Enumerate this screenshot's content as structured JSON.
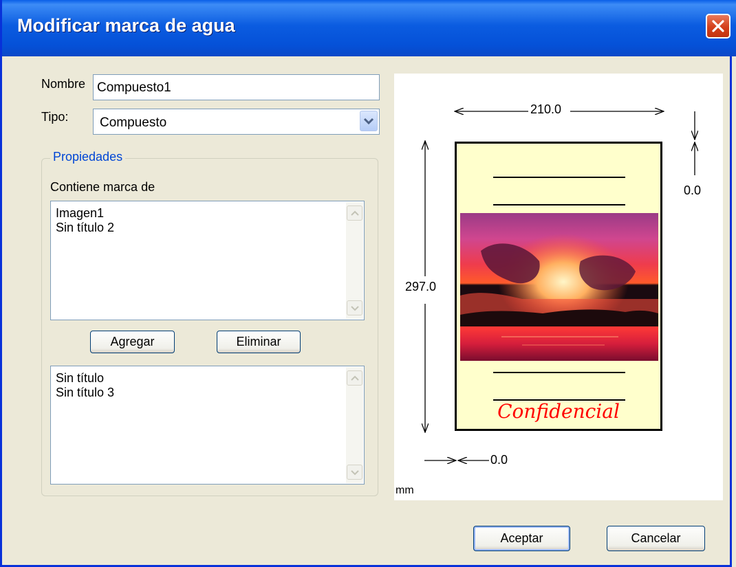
{
  "window": {
    "title": "Modificar marca de agua"
  },
  "form": {
    "name_label": "Nombre",
    "name_value": "Compuesto1",
    "type_label": "Tipo:",
    "type_value": "Compuesto"
  },
  "properties": {
    "legend": "Propiedades",
    "contains_label": "Contiene marca de",
    "included": [
      "Imagen1",
      "Sin título 2"
    ],
    "available": [
      "Sin título",
      "Sin título 3"
    ],
    "add_label": "Agregar",
    "remove_label": "Eliminar"
  },
  "preview": {
    "width_value": "210.0",
    "height_value": "297.0",
    "top_offset": "0.0",
    "left_offset": "0.0",
    "unit": "mm",
    "watermark_text": "Confidencial",
    "page_color": "#ffffcc",
    "watermark_color": "#ff0000"
  },
  "buttons": {
    "ok_label": "Aceptar",
    "cancel_label": "Cancelar"
  }
}
